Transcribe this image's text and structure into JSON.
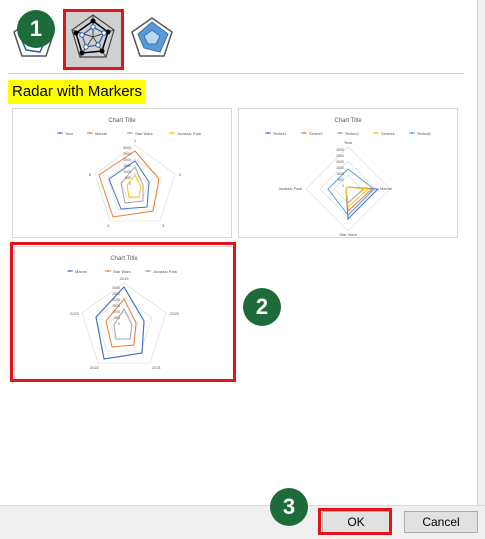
{
  "chart_types": [
    {
      "name": "Radar"
    },
    {
      "name": "Radar with Markers",
      "selected": true
    },
    {
      "name": "Filled Radar"
    }
  ],
  "section_title": "Radar with Markers",
  "steps": {
    "one": "1",
    "two": "2",
    "three": "3"
  },
  "buttons": {
    "ok": "OK",
    "cancel": "Cancel"
  },
  "colors": {
    "accent_red": "#e3131b",
    "badge_green": "#1e6b3a",
    "highlight_yellow": "#ffff00",
    "series_blue": "#4472c4",
    "series_orange": "#ed7d31",
    "series_gray": "#a5a5a5",
    "series_yellow": "#ffc000",
    "series_lightblue": "#5b9bd5"
  },
  "previews": [
    {
      "title": "Chart Title",
      "legend": [
        "Year",
        "Marvel",
        "Star Wars",
        "Jurassic Park"
      ],
      "axes": [
        "1",
        "2",
        "3",
        "4",
        "5"
      ],
      "ticks": [
        "3000",
        "2500",
        "2000",
        "1500",
        "1000",
        "500",
        "0"
      ]
    },
    {
      "title": "Chart Title",
      "legend": [
        "Series1",
        "Series2",
        "Series3",
        "Series4",
        "Series5"
      ],
      "axes": [
        "Year",
        "Marvel",
        "Star Wars",
        "Jurassic Park"
      ],
      "ticks": [
        "3000",
        "2500",
        "2000",
        "1500",
        "1000",
        "500",
        "0"
      ]
    },
    {
      "title": "Chart Title",
      "legend": [
        "Marvel",
        "Star Wars",
        "Jurassic Park"
      ],
      "axes": [
        "2019",
        "2020",
        "2021",
        "2022",
        "2023"
      ],
      "ticks": [
        "3000",
        "2500",
        "2000",
        "1500",
        "1000",
        "500",
        "0"
      ]
    }
  ]
}
